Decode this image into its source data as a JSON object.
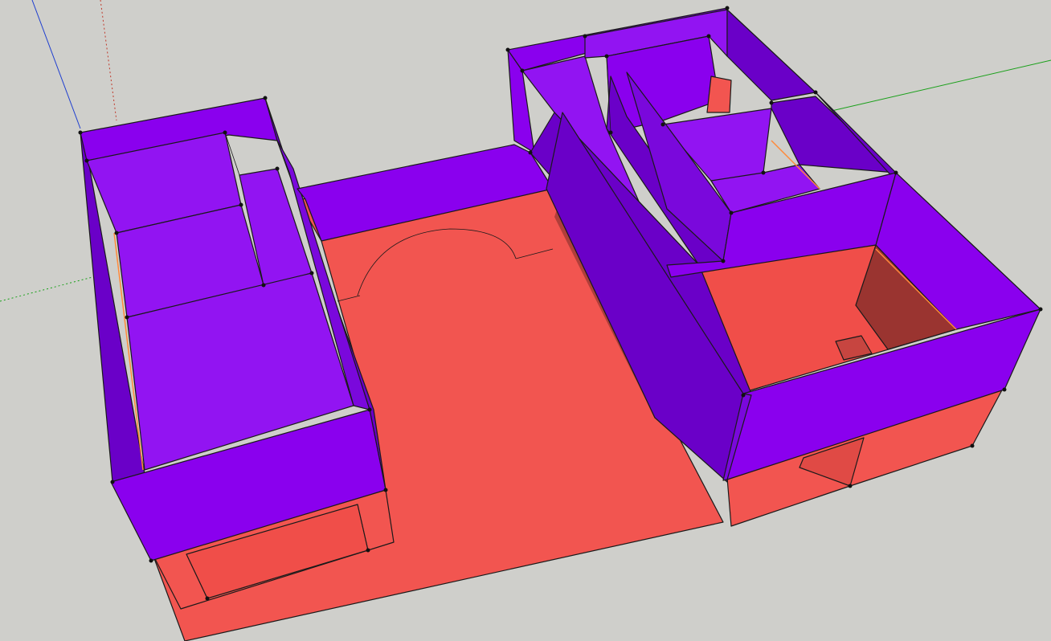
{
  "viewport": {
    "background_color": "#cfcfcb"
  },
  "colors": {
    "wall_top": "#8a00ee",
    "wall_face_light": "#9214f2",
    "wall_face_dark": "#6a00c8",
    "floor": "#f25550",
    "floor_shade": "#c74540",
    "floor_dark": "#9a3430",
    "edge": "#1a1a1a",
    "axis_red": "#c0392b",
    "axis_green": "#1aa01a",
    "axis_blue": "#1f3fd0"
  },
  "axes": [
    {
      "name": "red-axis",
      "color": "#c0392b",
      "style": "dotted"
    },
    {
      "name": "green-axis",
      "color": "#1aa01a",
      "style": "solid"
    },
    {
      "name": "blue-axis",
      "color": "#1f3fd0",
      "style": "solid"
    }
  ]
}
